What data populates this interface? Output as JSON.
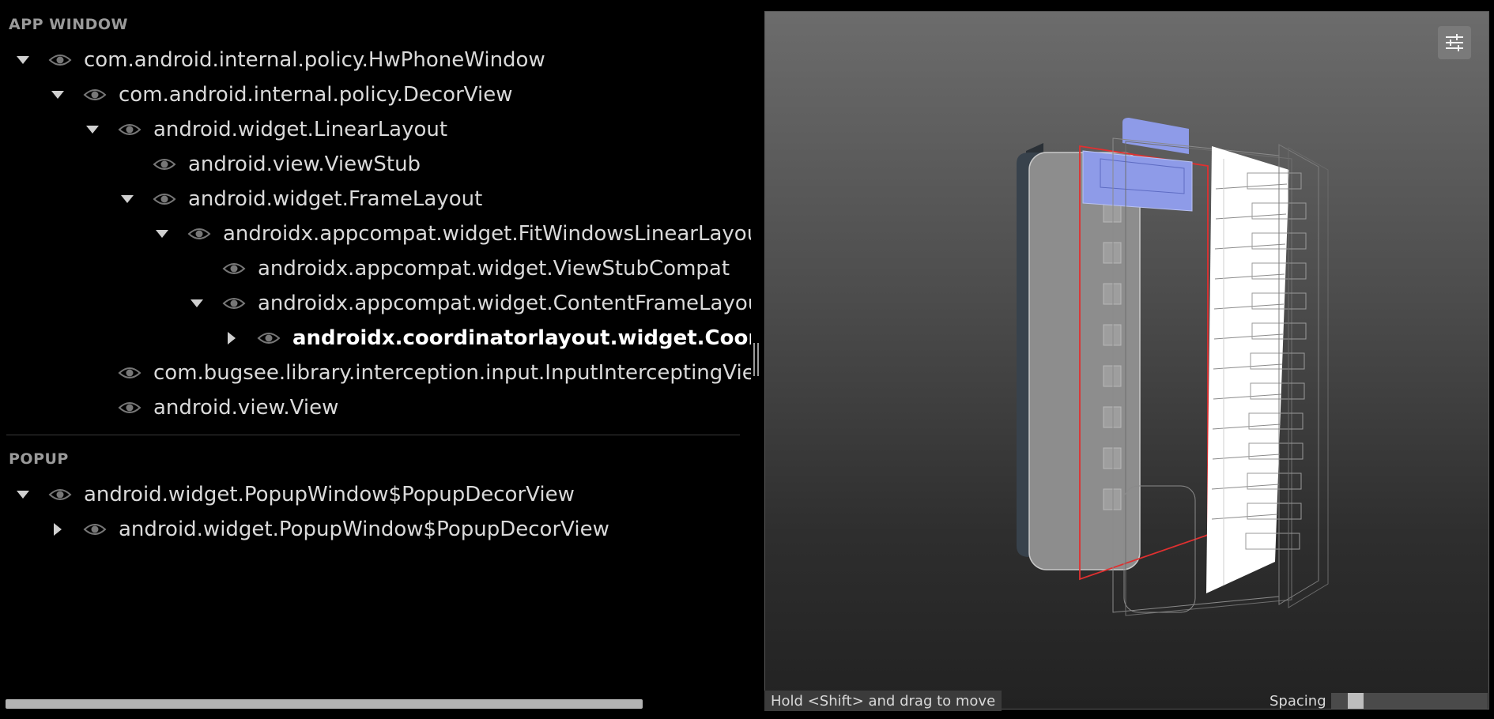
{
  "sections": {
    "app_window": {
      "title": "APP WINDOW",
      "nodes": [
        {
          "label": "com.android.internal.policy.HwPhoneWindow",
          "depth": 0,
          "toggle": "expanded"
        },
        {
          "label": "com.android.internal.policy.DecorView",
          "depth": 1,
          "toggle": "expanded"
        },
        {
          "label": "android.widget.LinearLayout",
          "depth": 2,
          "toggle": "expanded"
        },
        {
          "label": "android.view.ViewStub",
          "depth": 3,
          "toggle": "none"
        },
        {
          "label": "android.widget.FrameLayout",
          "depth": 3,
          "toggle": "expanded"
        },
        {
          "label": "androidx.appcompat.widget.FitWindowsLinearLayout",
          "depth": 4,
          "toggle": "expanded"
        },
        {
          "label": "androidx.appcompat.widget.ViewStubCompat",
          "depth": 5,
          "toggle": "none"
        },
        {
          "label": "androidx.appcompat.widget.ContentFrameLayout",
          "depth": 5,
          "toggle": "expanded"
        },
        {
          "label": "androidx.coordinatorlayout.widget.Coordin",
          "depth": 6,
          "toggle": "collapsed",
          "selected": true
        },
        {
          "label": "com.bugsee.library.interception.input.InputInterceptingView",
          "depth": 2,
          "toggle": "none"
        },
        {
          "label": "android.view.View",
          "depth": 2,
          "toggle": "none"
        }
      ]
    },
    "popup": {
      "title": "POPUP",
      "nodes": [
        {
          "label": "android.widget.PopupWindow$PopupDecorView",
          "depth": 0,
          "toggle": "expanded"
        },
        {
          "label": "android.widget.PopupWindow$PopupDecorView",
          "depth": 1,
          "toggle": "collapsed"
        }
      ]
    }
  },
  "viewport": {
    "hint": "Hold <Shift> and drag to move",
    "spacing_label": "Spacing",
    "spacing_value": 0.12,
    "settings_icon": "sliders-icon",
    "colors": {
      "selection_outline": "#e03030",
      "highlight_layer": "#8e9be8",
      "accent_layer": "#ffffff"
    }
  }
}
